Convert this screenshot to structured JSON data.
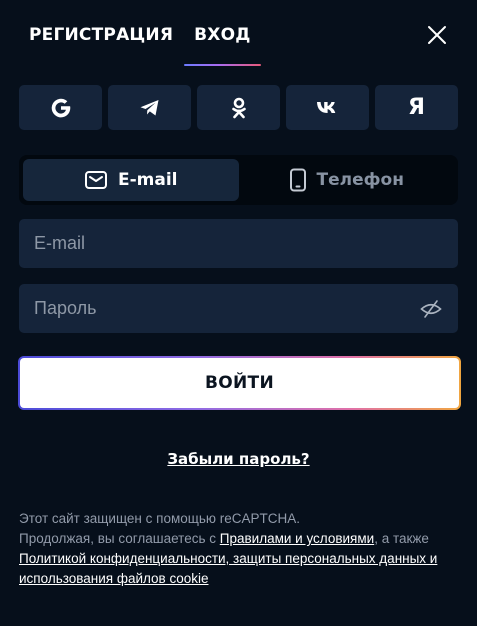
{
  "tabs": {
    "register": "РЕГИСТРАЦИЯ",
    "login": "ВХОД"
  },
  "close_icon": "close-icon",
  "socials": [
    {
      "name": "google-icon",
      "glyph": "G"
    },
    {
      "name": "telegram-icon",
      "glyph": ""
    },
    {
      "name": "odnoklassniki-icon",
      "glyph": ""
    },
    {
      "name": "vk-icon",
      "glyph": "VK"
    },
    {
      "name": "yandex-icon",
      "glyph": "Я"
    }
  ],
  "switcher": {
    "email_label": "E-mail",
    "phone_label": "Телефон"
  },
  "form": {
    "email_placeholder": "E-mail",
    "password_placeholder": "Пароль"
  },
  "login_button": "ВОЙТИ",
  "forgot_password": "Забыли пароль?",
  "legal": {
    "line1": "Этот сайт защищен с помощью reCAPTCHA.",
    "line2_prefix": "Продолжая, вы соглашаетесь с ",
    "terms_link": "Правилами и условиями",
    "line2_suffix": ", а также",
    "privacy_link": "Политикой конфиденциальности, защиты персональных данных и использования файлов cookie"
  },
  "colors": {
    "background": "#060f1b",
    "panel": "#15243a",
    "accent_gradient": [
      "#6c7bff",
      "#e85a7a"
    ]
  }
}
